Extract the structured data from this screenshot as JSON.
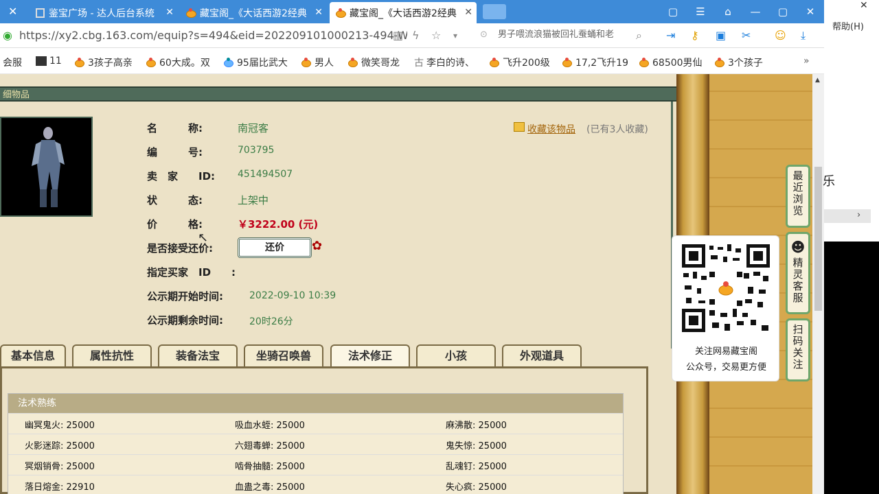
{
  "tabs": [
    {
      "label": "鉴宝广场 - 达人后台系统",
      "active": false
    },
    {
      "label": "藏宝阁_《大话西游2经典",
      "active": false
    },
    {
      "label": "藏宝阁_《大话西游2经典",
      "active": true
    }
  ],
  "toolbar": {
    "url": "https://xy2.cbg.163.com/equip?s=494&eid=202209101000213-494-W",
    "search_text": "男子喂流浪猫被回礼蚕蛹和老",
    "help_label": "帮助(H)"
  },
  "bookmarks": [
    "会服",
    "11",
    "3孩子高亲",
    "60大成。双",
    "95届比武大",
    "男人",
    "微笑哥龙",
    "李白的诗、",
    "飞升200级",
    "17,2飞升19",
    "68500男仙",
    "3个孩子"
  ],
  "section": {
    "title": "细物品"
  },
  "item": {
    "labels": {
      "name": "名　　　称:",
      "id": "编　　　号:",
      "seller": "卖　家　　ID:",
      "status": "状　　　态:",
      "price": "价　　　格:",
      "accept_offer": "是否接受还价:",
      "buyer": "指定买家　ID　　:",
      "public_start": "公示期开始时间:",
      "public_remaining": "公示期剩余时间:"
    },
    "name": "南冠客",
    "id": "703795",
    "seller_id": "451494507",
    "status": "上架中",
    "price": "￥3222.00 (元)",
    "counter_offer_label": "还价",
    "public_start": "2022-09-10 10:39",
    "public_remaining": "20时26分",
    "favorite_label": "收藏该物品",
    "favorite_count": "(已有3人收藏)"
  },
  "detail_tabs": [
    "基本信息",
    "属性抗性",
    "装备法宝",
    "坐骑召唤兽",
    "法术修正",
    "小孩",
    "外观道具"
  ],
  "selected_tab": "法术修正",
  "skills": {
    "title": "法术熟练",
    "rows": [
      [
        {
          "name": "幽冥鬼火",
          "value": "25000"
        },
        {
          "name": "吸血水蛭",
          "value": "25000"
        },
        {
          "name": "麻沸散",
          "value": "25000"
        }
      ],
      [
        {
          "name": "火影迷踪",
          "value": "25000"
        },
        {
          "name": "六翅毒蝉",
          "value": "25000"
        },
        {
          "name": "鬼失惊",
          "value": "25000"
        }
      ],
      [
        {
          "name": "冥烟销骨",
          "value": "25000"
        },
        {
          "name": "啮骨抽髓",
          "value": "25000"
        },
        {
          "name": "乱魂钉",
          "value": "25000"
        }
      ],
      [
        {
          "name": "落日熔金",
          "value": "22910"
        },
        {
          "name": "血蛊之毒",
          "value": "25000"
        },
        {
          "name": "失心疯",
          "value": "25000"
        }
      ]
    ]
  },
  "side_buttons": [
    "最近浏览",
    "精灵客服",
    "扫码关注"
  ],
  "qr": {
    "line1": "关注网易藏宝阁",
    "line2": "公众号，交易更方便"
  },
  "outside": {
    "le": "乐"
  }
}
